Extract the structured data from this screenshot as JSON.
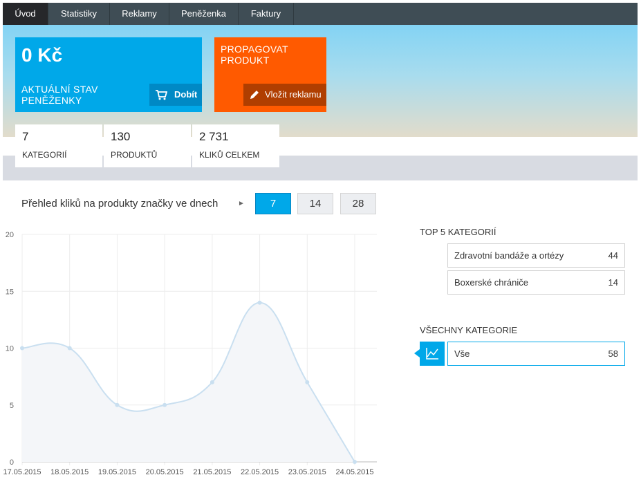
{
  "nav": {
    "tabs": [
      {
        "label": "Úvod"
      },
      {
        "label": "Statistiky"
      },
      {
        "label": "Reklamy"
      },
      {
        "label": "Peněženka"
      },
      {
        "label": "Faktury"
      }
    ]
  },
  "wallet": {
    "amount": "0 Kč",
    "label": "AKTUÁLNÍ STAV PENĚŽENKY",
    "button": "Dobít",
    "icon": "cart-icon"
  },
  "promo": {
    "label": "PROPAGOVAT PRODUKT",
    "button": "Vložit reklamu",
    "icon": "pencil-icon"
  },
  "stats": [
    {
      "value": "7",
      "label": "KATEGORIÍ"
    },
    {
      "value": "130",
      "label": "PRODUKTŮ"
    },
    {
      "value": "2 731",
      "label": "KLIKŮ CELKEM"
    }
  ],
  "overview": {
    "title": "Přehled kliků na produkty značky ve dnech",
    "arrow": "►",
    "ranges": [
      {
        "label": "7",
        "active": true
      },
      {
        "label": "14",
        "active": false
      },
      {
        "label": "28",
        "active": false
      }
    ]
  },
  "colors": {
    "accent": "#00a8e9",
    "promo": "#ff5a00",
    "nav": "#3f4d55"
  },
  "chart_data": {
    "type": "area",
    "x": [
      "17.05.2015",
      "18.05.2015",
      "19.05.2015",
      "20.05.2015",
      "21.05.2015",
      "22.05.2015",
      "23.05.2015",
      "24.05.2015"
    ],
    "values": [
      10,
      10,
      5,
      5,
      7,
      14,
      7,
      0
    ],
    "ylim": [
      0,
      20
    ],
    "yticks": [
      "0",
      "5",
      "10",
      "15",
      "20"
    ],
    "grid": true
  },
  "top5": {
    "title": "TOP 5 KATEGORIÍ",
    "items": [
      {
        "name": "Zdravotní bandáže a ortézy",
        "count": "44"
      },
      {
        "name": "Boxerské chrániče",
        "count": "14"
      }
    ]
  },
  "all": {
    "title": "VŠECHNY KATEGORIE",
    "icon": "line-chart-icon",
    "item": {
      "name": "Vše",
      "count": "58"
    }
  }
}
